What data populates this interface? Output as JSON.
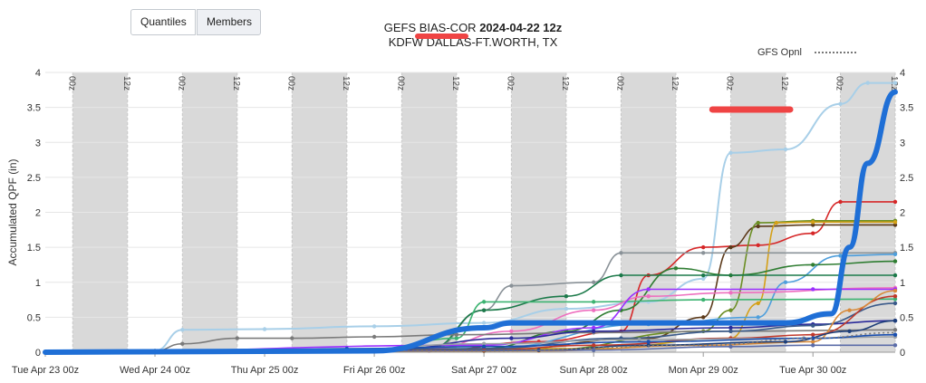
{
  "toolbar": {
    "quantiles_label": "Quantiles",
    "members_label": "Members"
  },
  "header": {
    "title_prefix": "GEFS BIAS-COR ",
    "title_run": "2024-04-22 12z",
    "subtitle": "KDFW DALLAS-FT.WORTH, TX"
  },
  "legend": {
    "gfs_label": "GFS Opnl",
    "gfs_color": "#777777"
  },
  "colors": {
    "median": "#1f6fd6",
    "highlight": "#ef4444",
    "band": "#d9d9d9"
  },
  "chart_data": {
    "type": "line",
    "title": "GEFS BIAS-COR 2024-04-22 12z",
    "subtitle": "KDFW DALLAS-FT.WORTH, TX",
    "xlabel": "",
    "ylabel": "Accumulated QPF (in)",
    "x_unit": "hours since Tue Apr 23 00z",
    "xlim": [
      0,
      186
    ],
    "ylim": [
      0,
      4
    ],
    "yticks": [
      "0",
      "0.5",
      "1",
      "1.5",
      "2",
      "2.5",
      "3",
      "3.5",
      "4"
    ],
    "ytick_values": [
      0,
      0.5,
      1,
      1.5,
      2,
      2.5,
      3,
      3.5,
      4
    ],
    "xtick_labels": [
      "Tue Apr 23 00z",
      "Wed Apr 24 00z",
      "Thu Apr 25 00z",
      "Fri Apr 26 00z",
      "Sat Apr 27 00z",
      "Sun Apr 28 00z",
      "Mon Apr 29 00z",
      "Tue Apr 30 00z"
    ],
    "xtick_values": [
      0,
      24,
      48,
      72,
      96,
      120,
      144,
      168
    ],
    "band_labels_00z": "00z",
    "band_labels_12z": "12z",
    "bands": [
      [
        6,
        18
      ],
      [
        30,
        42
      ],
      [
        54,
        66
      ],
      [
        78,
        90
      ],
      [
        102,
        114
      ],
      [
        126,
        138
      ],
      [
        150,
        162
      ],
      [
        174,
        186
      ]
    ],
    "grid": true,
    "series": [
      {
        "color": "#a8cfe8",
        "width": 2,
        "points": [
          [
            0,
            0
          ],
          [
            24,
            0.02
          ],
          [
            30,
            0.32
          ],
          [
            48,
            0.33
          ],
          [
            72,
            0.37
          ],
          [
            96,
            0.42
          ],
          [
            114,
            0.62
          ],
          [
            132,
            0.72
          ],
          [
            144,
            1.05
          ],
          [
            150,
            2.85
          ],
          [
            162,
            2.9
          ],
          [
            174,
            3.55
          ],
          [
            180,
            3.85
          ],
          [
            186,
            3.85
          ]
        ]
      },
      {
        "color": "#1f6fd6",
        "width": 6,
        "points": [
          [
            0,
            0
          ],
          [
            72,
            0.02
          ],
          [
            96,
            0.35
          ],
          [
            102,
            0.42
          ],
          [
            132,
            0.42
          ],
          [
            162,
            0.42
          ],
          [
            172,
            0.55
          ],
          [
            176,
            1.5
          ],
          [
            180,
            2.7
          ],
          [
            186,
            3.72
          ]
        ]
      },
      {
        "color": "#d62728",
        "width": 1.6,
        "points": [
          [
            0,
            0
          ],
          [
            84,
            0.02
          ],
          [
            108,
            0.15
          ],
          [
            126,
            0.3
          ],
          [
            132,
            1.1
          ],
          [
            144,
            1.5
          ],
          [
            156,
            1.53
          ],
          [
            168,
            1.7
          ],
          [
            174,
            2.15
          ],
          [
            186,
            2.15
          ]
        ]
      },
      {
        "color": "#5c3a1a",
        "width": 1.6,
        "points": [
          [
            0,
            0
          ],
          [
            96,
            0.02
          ],
          [
            132,
            0.2
          ],
          [
            144,
            0.5
          ],
          [
            150,
            1.5
          ],
          [
            156,
            1.8
          ],
          [
            168,
            1.82
          ],
          [
            186,
            1.82
          ]
        ]
      },
      {
        "color": "#6b8e23",
        "width": 1.6,
        "points": [
          [
            0,
            0
          ],
          [
            108,
            0.03
          ],
          [
            144,
            0.3
          ],
          [
            150,
            0.6
          ],
          [
            156,
            1.85
          ],
          [
            168,
            1.88
          ],
          [
            186,
            1.88
          ]
        ]
      },
      {
        "color": "#d4a017",
        "width": 1.6,
        "points": [
          [
            0,
            0
          ],
          [
            120,
            0.05
          ],
          [
            150,
            0.2
          ],
          [
            156,
            0.7
          ],
          [
            160,
            1.85
          ],
          [
            168,
            1.86
          ],
          [
            186,
            1.86
          ]
        ]
      },
      {
        "color": "#8a9298",
        "width": 1.6,
        "points": [
          [
            0,
            0
          ],
          [
            84,
            0.02
          ],
          [
            96,
            0.6
          ],
          [
            102,
            0.95
          ],
          [
            120,
            1.0
          ],
          [
            126,
            1.42
          ],
          [
            144,
            1.42
          ],
          [
            186,
            1.42
          ]
        ]
      },
      {
        "color": "#4f9fdc",
        "width": 1.6,
        "points": [
          [
            0,
            0
          ],
          [
            96,
            0.05
          ],
          [
            132,
            0.4
          ],
          [
            156,
            0.5
          ],
          [
            162,
            1.0
          ],
          [
            174,
            1.38
          ],
          [
            186,
            1.4
          ]
        ]
      },
      {
        "color": "#2f7d32",
        "width": 1.6,
        "points": [
          [
            0,
            0
          ],
          [
            96,
            0.05
          ],
          [
            114,
            0.3
          ],
          [
            126,
            0.6
          ],
          [
            138,
            1.2
          ],
          [
            150,
            1.1
          ],
          [
            168,
            1.25
          ],
          [
            186,
            1.3
          ]
        ]
      },
      {
        "color": "#1c7a4a",
        "width": 1.6,
        "points": [
          [
            0,
            0
          ],
          [
            84,
            0.05
          ],
          [
            96,
            0.6
          ],
          [
            114,
            0.8
          ],
          [
            126,
            1.1
          ],
          [
            144,
            1.1
          ],
          [
            186,
            1.1
          ]
        ]
      },
      {
        "color": "#3cb371",
        "width": 1.6,
        "points": [
          [
            0,
            0
          ],
          [
            72,
            0.02
          ],
          [
            90,
            0.2
          ],
          [
            96,
            0.72
          ],
          [
            120,
            0.72
          ],
          [
            144,
            0.75
          ],
          [
            186,
            0.76
          ]
        ]
      },
      {
        "color": "#ee6fbf",
        "width": 1.6,
        "points": [
          [
            0,
            0
          ],
          [
            84,
            0.05
          ],
          [
            102,
            0.3
          ],
          [
            120,
            0.6
          ],
          [
            132,
            0.8
          ],
          [
            150,
            0.85
          ],
          [
            186,
            0.92
          ]
        ]
      },
      {
        "color": "#9b30ff",
        "width": 1.6,
        "points": [
          [
            0,
            0
          ],
          [
            96,
            0.1
          ],
          [
            120,
            0.35
          ],
          [
            132,
            0.9
          ],
          [
            168,
            0.9
          ],
          [
            186,
            0.9
          ]
        ]
      },
      {
        "color": "#7a7a7a",
        "width": 1.6,
        "points": [
          [
            0,
            0
          ],
          [
            24,
            0.02
          ],
          [
            30,
            0.12
          ],
          [
            42,
            0.2
          ],
          [
            54,
            0.2
          ],
          [
            72,
            0.22
          ],
          [
            90,
            0.25
          ],
          [
            120,
            0.28
          ],
          [
            150,
            0.3
          ],
          [
            186,
            0.32
          ]
        ]
      },
      {
        "color": "#2a2a9a",
        "width": 1.6,
        "points": [
          [
            0,
            0
          ],
          [
            72,
            0.02
          ],
          [
            102,
            0.2
          ],
          [
            120,
            0.3
          ],
          [
            150,
            0.35
          ],
          [
            168,
            0.4
          ],
          [
            186,
            0.45
          ]
        ]
      },
      {
        "color": "#3a5a8a",
        "width": 1.6,
        "points": [
          [
            0,
            0
          ],
          [
            96,
            0.05
          ],
          [
            126,
            0.2
          ],
          [
            150,
            0.3
          ],
          [
            168,
            0.38
          ],
          [
            186,
            0.7
          ]
        ]
      },
      {
        "color": "#c0392b",
        "width": 1.6,
        "points": [
          [
            0,
            0
          ],
          [
            96,
            0.03
          ],
          [
            120,
            0.1
          ],
          [
            150,
            0.2
          ],
          [
            168,
            0.25
          ],
          [
            186,
            0.8
          ]
        ]
      },
      {
        "color": "#d88a3a",
        "width": 1.6,
        "points": [
          [
            0,
            0
          ],
          [
            108,
            0.02
          ],
          [
            144,
            0.1
          ],
          [
            168,
            0.15
          ],
          [
            176,
            0.6
          ],
          [
            186,
            0.88
          ]
        ]
      },
      {
        "color": "#1e3f7a",
        "width": 1.6,
        "points": [
          [
            0,
            0
          ],
          [
            108,
            0.03
          ],
          [
            132,
            0.1
          ],
          [
            162,
            0.15
          ],
          [
            176,
            0.3
          ],
          [
            186,
            0.45
          ]
        ]
      },
      {
        "color": "#5b6ca8",
        "width": 1.6,
        "points": [
          [
            0,
            0
          ],
          [
            120,
            0.03
          ],
          [
            150,
            0.08
          ],
          [
            168,
            0.1
          ],
          [
            186,
            0.1
          ]
        ]
      },
      {
        "color": "#9aa0a6",
        "width": 1.6,
        "points": [
          [
            0,
            0
          ],
          [
            60,
            0.02
          ],
          [
            96,
            0.12
          ],
          [
            130,
            0.18
          ],
          [
            166,
            0.2
          ],
          [
            186,
            0.22
          ]
        ]
      },
      {
        "color": "#1a4fb0",
        "width": 1.6,
        "points": [
          [
            0,
            0
          ],
          [
            48,
            0.02
          ],
          [
            66,
            0.05
          ],
          [
            96,
            0.08
          ],
          [
            132,
            0.15
          ],
          [
            168,
            0.2
          ],
          [
            186,
            0.25
          ]
        ]
      }
    ],
    "gfs_opnl": {
      "name": "GFS Opnl",
      "points": [
        [
          0,
          0
        ],
        [
          96,
          0.02
        ],
        [
          144,
          0.1
        ],
        [
          168,
          0.2
        ],
        [
          186,
          0.28
        ]
      ]
    },
    "highlight_segment": {
      "color": "#ef4444",
      "x": [
        146,
        163
      ],
      "y": 3.47
    }
  }
}
